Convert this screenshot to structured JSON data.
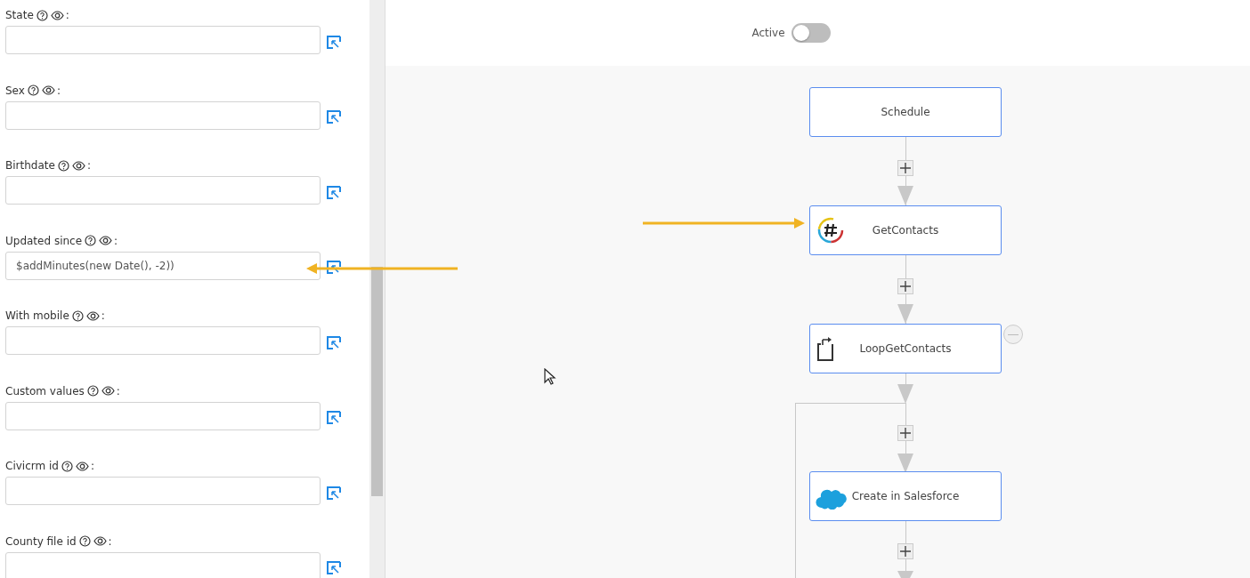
{
  "form": {
    "fields": [
      {
        "label": "State",
        "suffix": ":"
      },
      {
        "label": "Sex",
        "suffix": ":"
      },
      {
        "label": "Birthdate",
        "suffix": ":"
      },
      {
        "label": "Updated since",
        "suffix": ":",
        "value": "$addMinutes(new Date(), -2))"
      },
      {
        "label": "With mobile",
        "suffix": ":"
      },
      {
        "label": "Custom values",
        "suffix": ":"
      },
      {
        "label": "Civicrm id",
        "suffix": ":"
      },
      {
        "label": "County file id",
        "suffix": ":"
      }
    ]
  },
  "header": {
    "toggle": {
      "label": "Active",
      "on": false
    }
  },
  "flow": {
    "nodes": [
      {
        "label": "Schedule",
        "kind": "trigger"
      },
      {
        "label": "GetContacts",
        "kind": "hash"
      },
      {
        "label": "LoopGetContacts",
        "kind": "loop",
        "removable": true
      },
      {
        "label": "Create in Salesforce",
        "kind": "cloud"
      }
    ]
  }
}
